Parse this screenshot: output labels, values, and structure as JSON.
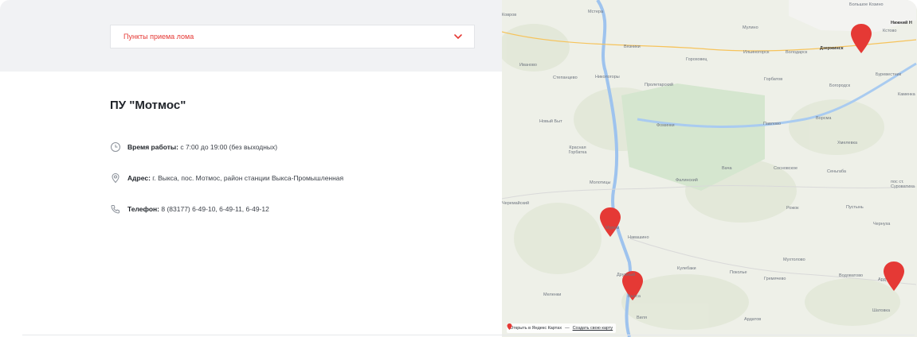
{
  "filter": {
    "selected": "Пункты приема лома",
    "chevron_icon": "chevron-down-icon",
    "accent_color": "#e53935"
  },
  "point": {
    "title": "ПУ \"Мотмос\"",
    "hours_label": "Время работы:",
    "hours_value": "с 7:00 до 19:00 (без выходных)",
    "address_label": "Адрес:",
    "address_value": "г. Выкса, пос. Мотмос, район станции Выкса-Промышленная",
    "phone_label": "Телефон:",
    "phone_value": "8 (83177) 6-49-10, 6-49-11, 6-49-12"
  },
  "map": {
    "labels": [
      "Мстера",
      "Мулино",
      "Нижний Н",
      "Большое Козино",
      "Ковров",
      "Вязники",
      "Ильиногорск",
      "Володарск",
      "Дзержинск",
      "Гороховец",
      "Горбатов",
      "Богородск",
      "Буревестник",
      "Кстово",
      "Иваново",
      "Степанцево",
      "Никологоры",
      "Пролетарский",
      "Новый Быт",
      "Фоминки",
      "Павлово",
      "Ворсма",
      "Каменка",
      "Красная Горбатка",
      "Хмелевка",
      "Мол­отицы",
      "Фалинский",
      "Вача",
      "Сосновское",
      "Сеньгаба",
      "пос ст. Суроватиха",
      "Муром",
      "Навашино",
      "Рожок",
      "Пустынь",
      "Черемайский",
      "Чернуха",
      "Мухтолово",
      "Кулебаки",
      "Поколье",
      "Гремячево",
      "Водоватово",
      "Ард",
      "Меленки",
      "Выкса",
      "Виля",
      "Ардатов",
      "Шатовка",
      "Дружный"
    ],
    "footer_open": "Открыть в Яндекс Картах",
    "footer_sep": "—",
    "footer_create": "Создать свою карту",
    "pin_color": "#e53935"
  }
}
